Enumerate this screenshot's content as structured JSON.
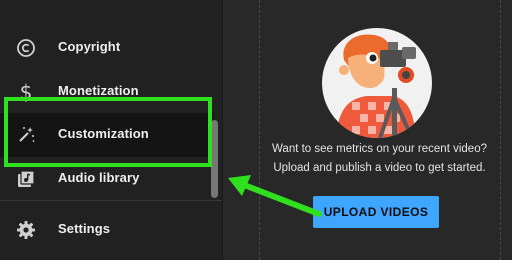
{
  "sidebar": {
    "items": [
      {
        "label": "Copyright",
        "icon": "copyright-icon"
      },
      {
        "label": "Monetization",
        "icon": "dollar-icon"
      },
      {
        "label": "Customization",
        "icon": "magic-wand-icon",
        "active": true
      },
      {
        "label": "Audio library",
        "icon": "audio-library-icon"
      },
      {
        "label": "Settings",
        "icon": "gear-icon"
      }
    ]
  },
  "main": {
    "empty_state": {
      "line1": "Want to see metrics on your recent video?",
      "line2": "Upload and publish a video to get started."
    },
    "upload_button": "UPLOAD VIDEOS"
  },
  "annotation": {
    "color": "#2ee01e"
  },
  "colors": {
    "accent": "#3ea6ff",
    "background": "#212121",
    "content_background": "#282828"
  }
}
